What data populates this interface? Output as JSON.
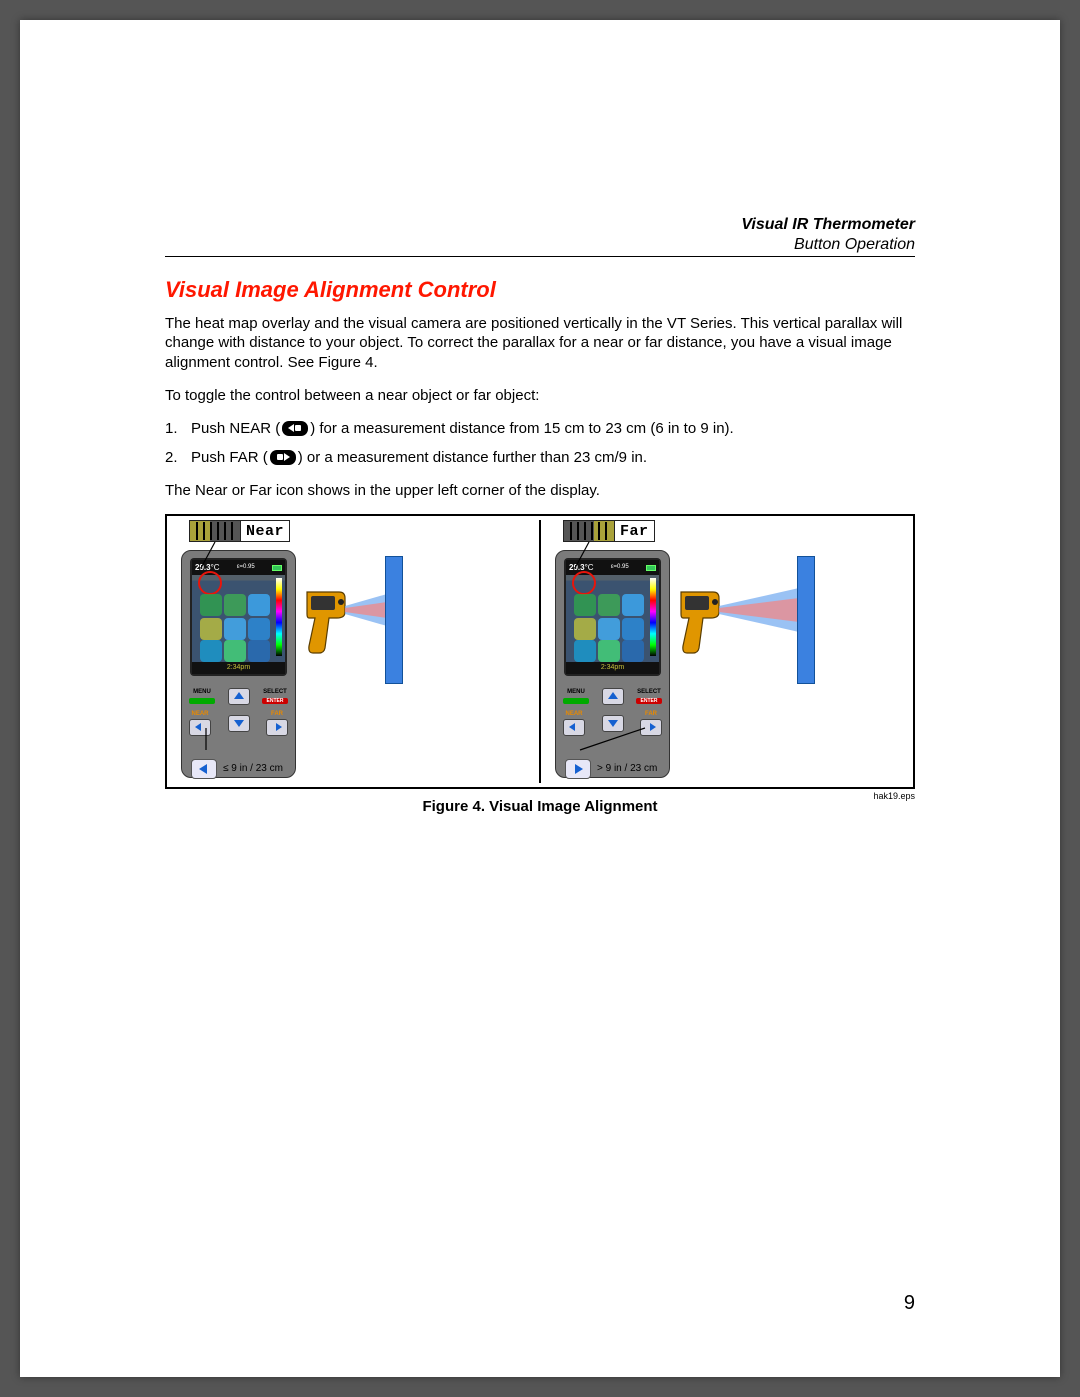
{
  "header": {
    "line1": "Visual IR Thermometer",
    "line2": "Button Operation"
  },
  "section_title": "Visual Image Alignment Control",
  "para1": "The heat map overlay and the visual camera are positioned vertically in the VT Series. This vertical parallax will change with distance to your object. To correct the parallax for a near or far distance, you have a visual image alignment control. See Figure 4.",
  "para2": "To toggle the control between a near object or far object:",
  "steps": [
    {
      "num": "1.",
      "pre": "Push NEAR (",
      "post": ") for a measurement distance from 15 cm to 23 cm (6 in to 9 in)."
    },
    {
      "num": "2.",
      "pre": "Push FAR (",
      "post": ") or a measurement distance further than 23 cm/9 in."
    }
  ],
  "para3": "The Near or Far icon shows in the upper left corner of the display.",
  "figure": {
    "near": {
      "badge": "Near",
      "temp": "29.3",
      "unit": "°C",
      "emiss": "ε=0.95",
      "time": "2:34pm",
      "foot": "≤ 9 in / 23 cm"
    },
    "far": {
      "badge": "Far",
      "temp": "29.3",
      "unit": "°C",
      "emiss": "ε=0.95",
      "time": "2:34pm",
      "foot": "> 9 in / 23 cm"
    },
    "keypad": {
      "menu": "MENU",
      "menu_sub": "",
      "select": "SELECT",
      "enter": "ENTER",
      "near": "NEAR",
      "far": "FAR"
    }
  },
  "eps": "hak19.eps",
  "figcaption": "Figure 4. Visual Image Alignment",
  "page_number": "9"
}
